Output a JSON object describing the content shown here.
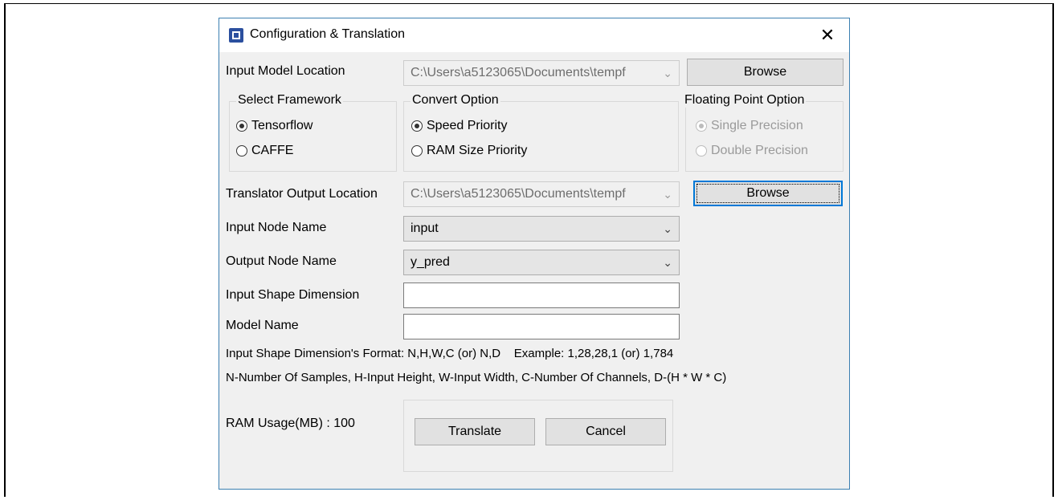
{
  "dialog": {
    "title": "Configuration & Translation",
    "close_label": "✕"
  },
  "input_model": {
    "label": "Input Model Location",
    "value": "C:\\Users\\a5123065\\Documents\\tempf",
    "browse_label": "Browse"
  },
  "framework": {
    "title": "Select Framework",
    "options": [
      {
        "label": "Tensorflow",
        "selected": true
      },
      {
        "label": "CAFFE",
        "selected": false
      }
    ]
  },
  "convert": {
    "title": "Convert Option",
    "options": [
      {
        "label": "Speed Priority",
        "selected": true
      },
      {
        "label": "RAM Size Priority",
        "selected": false
      }
    ]
  },
  "floating": {
    "title": "Floating Point Option",
    "options": [
      {
        "label": "Single Precision",
        "selected": true
      },
      {
        "label": "Double Precision",
        "selected": false
      }
    ]
  },
  "output_location": {
    "label": "Translator Output Location",
    "value": "C:\\Users\\a5123065\\Documents\\tempf",
    "browse_label": "Browse"
  },
  "input_node": {
    "label": "Input Node Name",
    "value": "input"
  },
  "output_node": {
    "label": "Output Node Name",
    "value": "y_pred"
  },
  "shape_dim": {
    "label": "Input Shape Dimension",
    "value": ""
  },
  "model_name": {
    "label": "Model Name",
    "value": ""
  },
  "hints": {
    "format": "Input Shape Dimension's Format: N,H,W,C (or) N,D    Example: 1,28,28,1 (or) 1,784",
    "legend": "N-Number Of Samples, H-Input Height, W-Input Width, C-Number Of Channels, D-(H * W * C)"
  },
  "ram_usage": "RAM Usage(MB) : 100",
  "actions": {
    "translate": "Translate",
    "cancel": "Cancel"
  },
  "icons": {
    "app": "app-chip-icon",
    "dropdown": "chevron-down-icon",
    "close": "close-icon"
  },
  "colors": {
    "accent": "#0078d7",
    "dialog_border": "#3c7fb1",
    "dialog_bg": "#f0f0f0"
  }
}
